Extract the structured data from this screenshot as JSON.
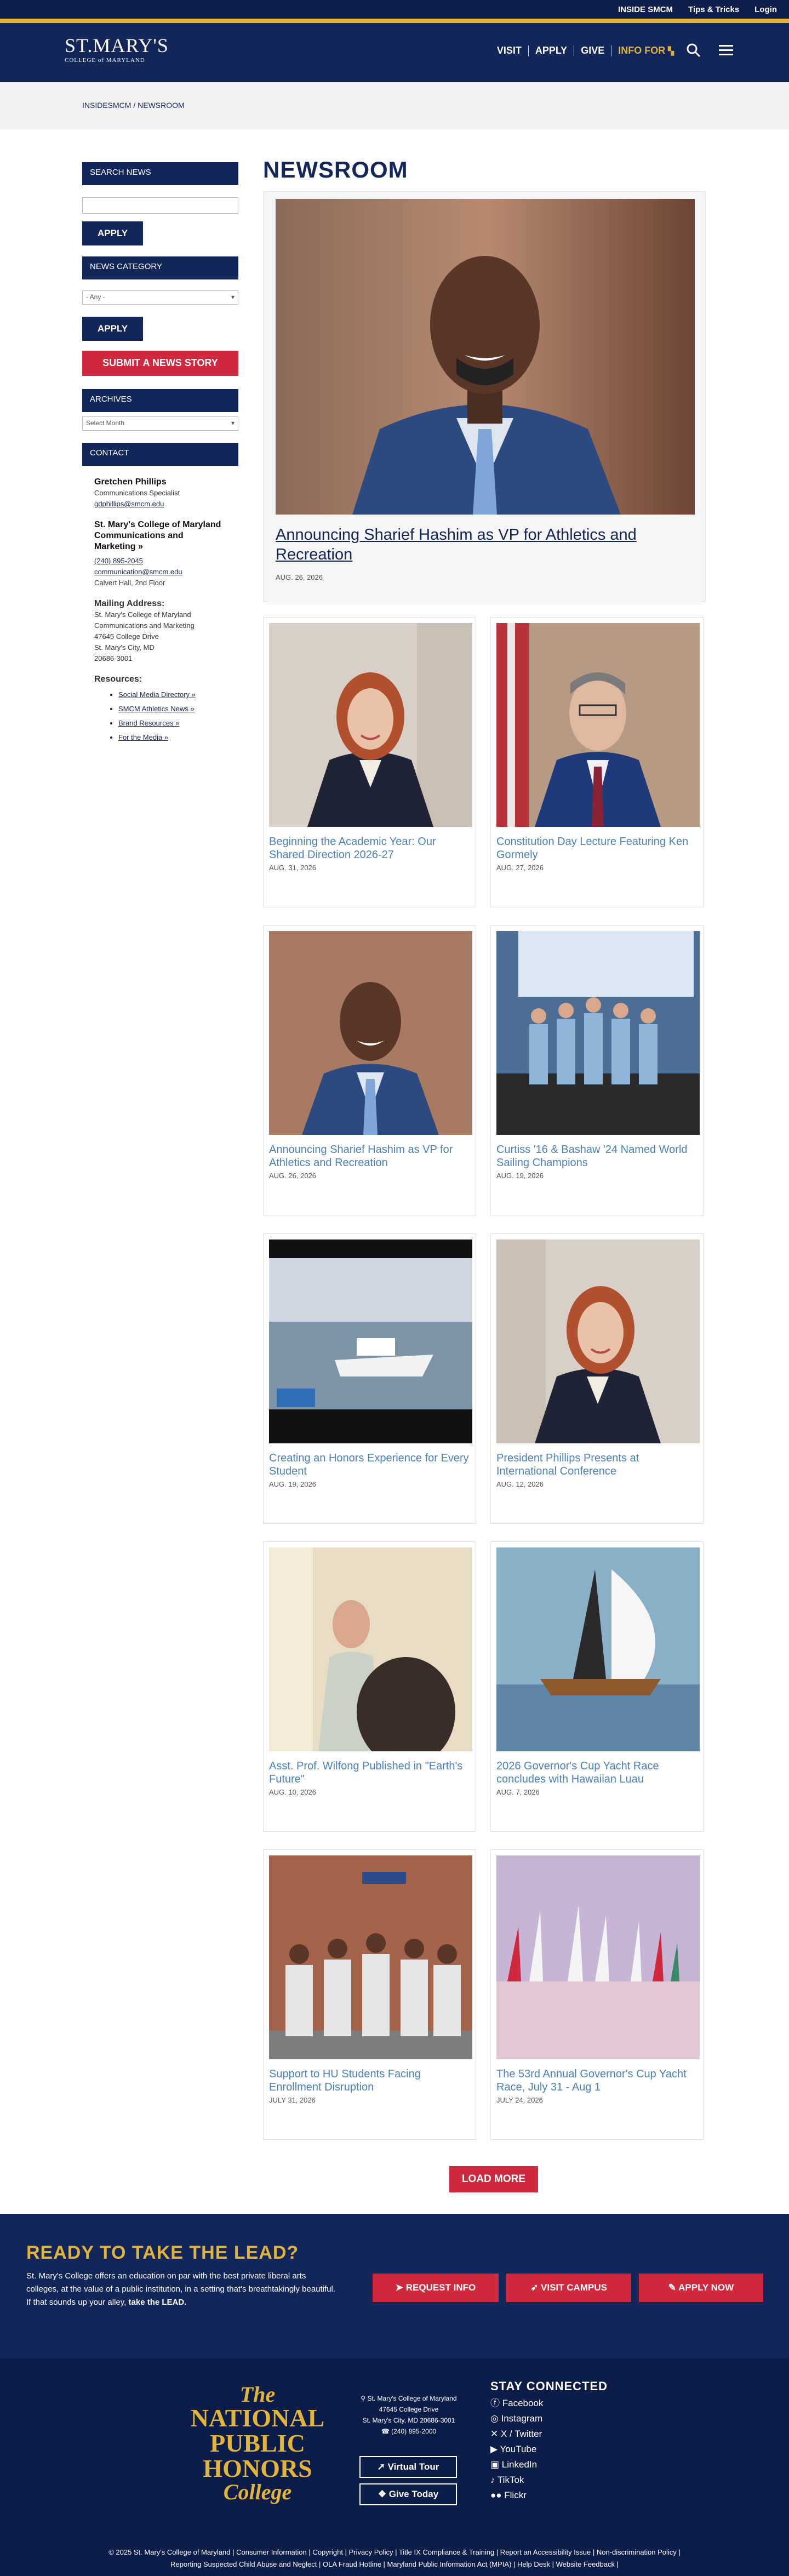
{
  "utility": [
    "INSIDE SMCM",
    "Tips & Tricks",
    "Login"
  ],
  "logo": {
    "line1": "ST.MARY'S",
    "line2": "COLLEGE of MARYLAND"
  },
  "nav": {
    "visit": "VISIT",
    "apply": "APPLY",
    "give": "GIVE",
    "info": "INFO FOR"
  },
  "breadcrumb": "INSIDESMCM / NEWSROOM",
  "sidebar": {
    "search_head": "SEARCH NEWS",
    "apply1": "APPLY",
    "category_head": "NEWS CATEGORY",
    "category_value": "- Any -",
    "apply2": "APPLY",
    "submit": "SUBMIT A NEWS STORY",
    "archives_head": "ARCHIVES",
    "archives_value": "Select Month",
    "contact_head": "CONTACT",
    "contact_name": "Gretchen Phillips",
    "contact_title": "Communications Specialist",
    "contact_email": "gdphillips@smcm.edu",
    "org": "St. Mary's College of Maryland Communications and Marketing »",
    "phone": "(240) 895-2045",
    "org_email": "communication@smcm.edu",
    "office": "Calvert Hall, 2nd Floor",
    "mail_head": "Mailing Address:",
    "mail1": "St. Mary's College of Maryland",
    "mail2": "Communications and Marketing",
    "mail3": "47645 College Drive",
    "mail4": "St. Mary's City, MD",
    "mail5": "20686-3001",
    "res_head": "Resources:",
    "resources": [
      "Social Media Directory »",
      "SMCM Athletics News »",
      "Brand Resources »",
      "For the Media »"
    ]
  },
  "page_title": "NEWSROOM",
  "featured": {
    "title": "Announcing Sharief Hashim as VP for Athletics and Recreation",
    "date": "AUG. 26, 2026"
  },
  "cards": [
    {
      "title": "Beginning the Academic Year: Our Shared Direction 2026-27",
      "date": "AUG. 31, 2026"
    },
    {
      "title": "Constitution Day Lecture Featuring Ken Gormely",
      "date": "AUG. 27, 2026"
    },
    {
      "title": "Announcing Sharief Hashim as VP for Athletics and Recreation",
      "date": "AUG. 26, 2026"
    },
    {
      "title": "Curtiss '16 & Bashaw '24 Named World Sailing Champions",
      "date": "AUG. 19, 2026"
    },
    {
      "title": "Creating an Honors Experience for Every Student",
      "date": "AUG. 19, 2026"
    },
    {
      "title": "President Phillips Presents at International Conference",
      "date": "AUG. 12, 2026"
    },
    {
      "title": "Asst. Prof. Wilfong Published in \"Earth's Future\"",
      "date": "AUG. 10, 2026"
    },
    {
      "title": "2026 Governor's Cup Yacht Race concludes with Hawaiian Luau",
      "date": "AUG. 7, 2026"
    },
    {
      "title": "Support to HU Students Facing Enrollment Disruption",
      "date": "JULY 31, 2026"
    },
    {
      "title": "The 53rd Annual Governor's Cup Yacht Race, July 31 - Aug 1",
      "date": "JULY 24, 2026"
    }
  ],
  "load_more": "LOAD MORE",
  "cta": {
    "title": "READY TO TAKE THE LEAD?",
    "body": "St. Mary's College offers an education on par with the best private liberal arts colleges, at the value of a public institution, in a setting that's breathtakingly beautiful.",
    "body2": "If that sounds up your alley,",
    "body2b": "take the LEAD.",
    "request": "REQUEST INFO",
    "visit": "VISIT CAMPUS",
    "apply": "APPLY NOW"
  },
  "footer": {
    "honors1": "The",
    "honors2": "NATIONAL",
    "honors3": "PUBLIC",
    "honors4": "HONORS",
    "honors5": "College",
    "addr1": "St. Mary's College of Maryland",
    "addr2": "47645 College Drive",
    "addr3": "St. Mary's City, MD 20686-3001",
    "addr4": "(240) 895-2000",
    "tour": "Virtual Tour",
    "give": "Give Today",
    "stay": "STAY CONNECTED",
    "social": [
      "Facebook",
      "Instagram",
      "X / Twitter",
      "YouTube",
      "LinkedIn",
      "TikTok",
      "Flickr"
    ],
    "links1": "© 2025 St. Mary's College of Maryland  |  Consumer Information  |  Copyright  |  Privacy Policy  |  Title IX Compliance & Training  |  Report an Accessibility Issue  |  Non-discrimination Policy  |",
    "links2": "Reporting Suspected Child Abuse and Neglect  |  OLA Fraud Hotline  |  Maryland Public Information Act (MPIA)  |  Help Desk  |  Website Feedback  |"
  }
}
